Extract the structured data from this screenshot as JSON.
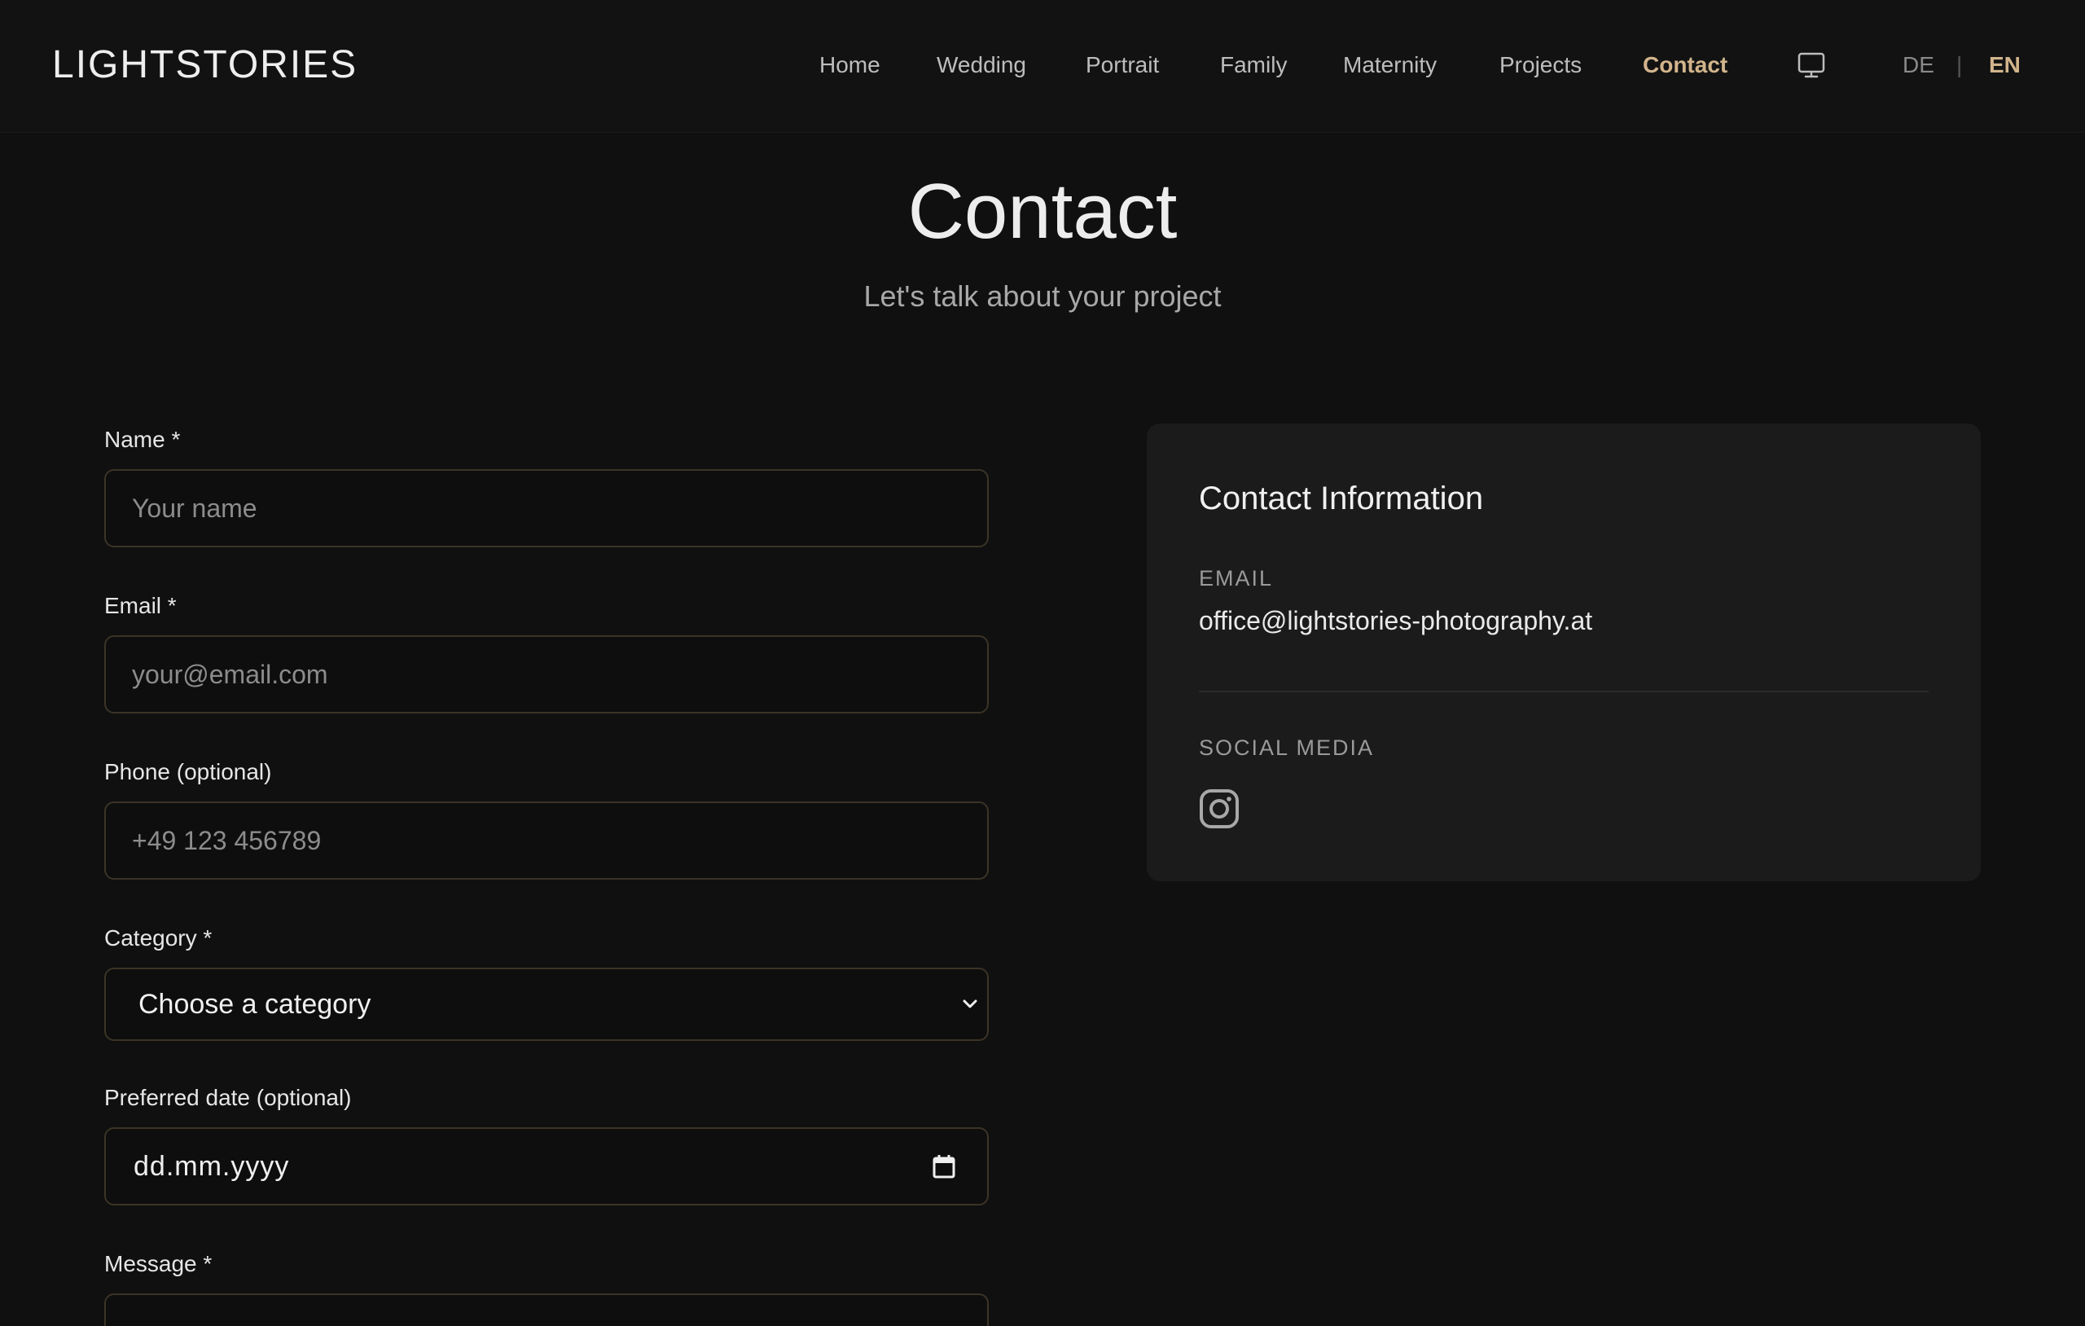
{
  "header": {
    "logo": "LIGHTSTORIES",
    "nav": [
      {
        "label": "Home",
        "active": false
      },
      {
        "label": "Wedding",
        "active": false
      },
      {
        "label": "Portrait",
        "active": false
      },
      {
        "label": "Family",
        "active": false
      },
      {
        "label": "Maternity",
        "active": false
      },
      {
        "label": "Projects",
        "active": false
      },
      {
        "label": "Contact",
        "active": true
      }
    ],
    "display_icon": "monitor-icon",
    "lang": {
      "de": "DE",
      "separator": "|",
      "en": "EN",
      "active": "EN"
    }
  },
  "page": {
    "title": "Contact",
    "subtitle": "Let's talk about your project"
  },
  "form": {
    "name": {
      "label": "Name *",
      "placeholder": "Your name",
      "value": ""
    },
    "email": {
      "label": "Email *",
      "placeholder": "your@email.com",
      "value": ""
    },
    "phone": {
      "label": "Phone (optional)",
      "placeholder": "+49 123 456789",
      "value": ""
    },
    "category": {
      "label": "Category *",
      "selected": "Choose a category"
    },
    "date": {
      "label": "Preferred date (optional)",
      "value": "dd.mm.yyyy"
    },
    "message": {
      "label": "Message *"
    }
  },
  "contact_info": {
    "title": "Contact Information",
    "email_label": "EMAIL",
    "email": "office@lightstories-photography.at",
    "social_label": "SOCIAL MEDIA",
    "social_icons": [
      "instagram-icon"
    ]
  },
  "colors": {
    "background": "#101010",
    "card": "#1b1b1b",
    "accent": "#d2b48c",
    "field_border": "#3b3426"
  }
}
